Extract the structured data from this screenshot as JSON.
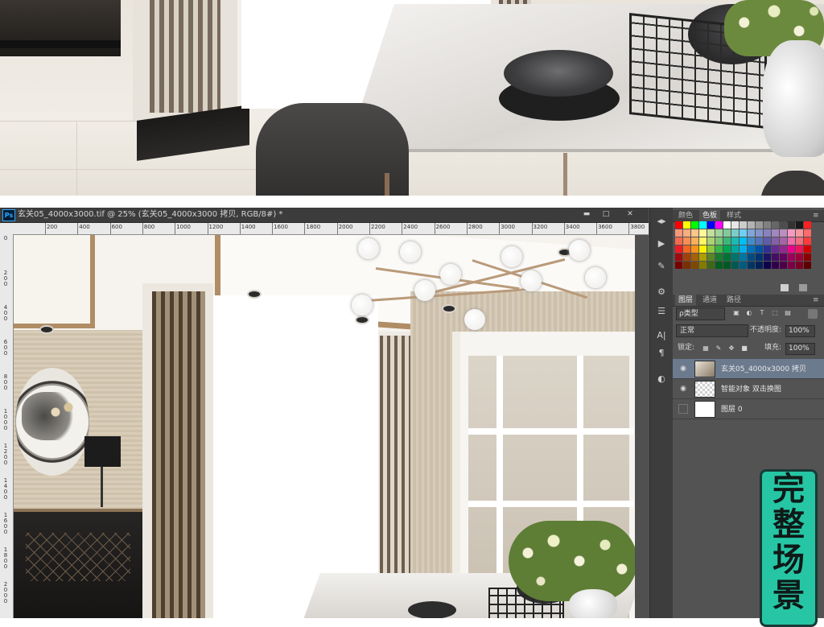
{
  "window": {
    "app_logo": "Ps",
    "title": "玄关05_4000x3000.tif @ 25% (玄关05_4000x3000 拷贝, RGB/8#) *",
    "min_label": "▬",
    "max_label": "□",
    "close_label": "✕"
  },
  "ruler": {
    "top_ticks": [
      "200",
      "400",
      "600",
      "800",
      "1000",
      "1200",
      "1400",
      "1600",
      "1800",
      "2000",
      "2200",
      "2400",
      "2600",
      "2800",
      "3000",
      "3200",
      "3400",
      "3600",
      "3800"
    ],
    "left_ticks": [
      "0",
      "200",
      "400",
      "600",
      "800",
      "1000",
      "1200",
      "1400",
      "1600",
      "1800",
      "2000"
    ]
  },
  "tools": [
    {
      "icon": "collapse-arrows-icon",
      "glyph": "◂▸"
    },
    {
      "icon": "play-icon",
      "glyph": "▶"
    },
    {
      "icon": "brush-settings-icon",
      "glyph": "✎"
    },
    {
      "icon": "adjust-icon",
      "glyph": "⚙"
    },
    {
      "icon": "sliders-icon",
      "glyph": "☰"
    },
    {
      "icon": "character-icon",
      "glyph": "A|"
    },
    {
      "icon": "paragraph-icon",
      "glyph": "¶"
    },
    {
      "icon": "adjustments-icon",
      "glyph": "◐"
    }
  ],
  "color_panel": {
    "tabs": [
      "颜色",
      "色板",
      "样式"
    ],
    "active_tab": "色板",
    "swatch_colors": [
      [
        "#ff0000",
        "#ffff00",
        "#00ff00",
        "#00ffff",
        "#0000ff",
        "#ff00ff",
        "#ffffff",
        "#e6e6e6",
        "#cccccc",
        "#b3b3b3",
        "#999999",
        "#808080",
        "#666666",
        "#4d4d4d",
        "#333333",
        "#1a1a1a",
        "#ff2020"
      ],
      [
        "#f7977a",
        "#f9ad81",
        "#fdc68a",
        "#fff79a",
        "#c4df9b",
        "#a2d39c",
        "#82ca9d",
        "#7bcdc8",
        "#6ecff6",
        "#7ea7d8",
        "#8493ca",
        "#8882be",
        "#a187be",
        "#bc8dbf",
        "#f49ac2",
        "#f6989d",
        "#ff6b6b"
      ],
      [
        "#f26c4f",
        "#f68e55",
        "#fbaf5c",
        "#fff467",
        "#acd372",
        "#7cc576",
        "#3bb878",
        "#1abbb4",
        "#00bff3",
        "#438cca",
        "#5574b9",
        "#605ca8",
        "#855fa8",
        "#a763a8",
        "#f06ea9",
        "#f26d7d",
        "#ff3b3b"
      ],
      [
        "#ed1c24",
        "#f26522",
        "#f7941d",
        "#fff200",
        "#8dc73f",
        "#39b54a",
        "#00a651",
        "#00a99d",
        "#00aeef",
        "#0072bc",
        "#0054a6",
        "#2e3192",
        "#662d91",
        "#92278f",
        "#ec008c",
        "#ed145b",
        "#d40000"
      ],
      [
        "#9e0b0f",
        "#a0410d",
        "#a36209",
        "#aba000",
        "#598527",
        "#1a7b30",
        "#007236",
        "#00746b",
        "#0076a3",
        "#004b80",
        "#003471",
        "#1b1464",
        "#440e62",
        "#630460",
        "#9e005d",
        "#9e0039",
        "#8b0000"
      ],
      [
        "#790000",
        "#7b2e00",
        "#7d4900",
        "#827b00",
        "#406618",
        "#005e20",
        "#005826",
        "#005952",
        "#005b7f",
        "#003663",
        "#002157",
        "#0d004c",
        "#32004b",
        "#4b0049",
        "#7b0046",
        "#7a0026",
        "#5c0000"
      ]
    ]
  },
  "layers_panel": {
    "tabs": [
      "图层",
      "通道",
      "路径"
    ],
    "active_tab": "图层",
    "filter_label": "ρ类型",
    "blend_mode": "正常",
    "opacity_label": "不透明度:",
    "opacity_value": "100%",
    "lock_label": "锁定:",
    "fill_label": "填充:",
    "fill_value": "100%",
    "layers": [
      {
        "name": "玄关05_4000x3000 拷贝",
        "visible": true,
        "selected": true
      },
      {
        "name": "智能对象 双击换图",
        "visible": true,
        "selected": false
      },
      {
        "name": "图层 0",
        "visible": false,
        "selected": false
      }
    ]
  },
  "promo_badge": {
    "text": "完整场景"
  }
}
